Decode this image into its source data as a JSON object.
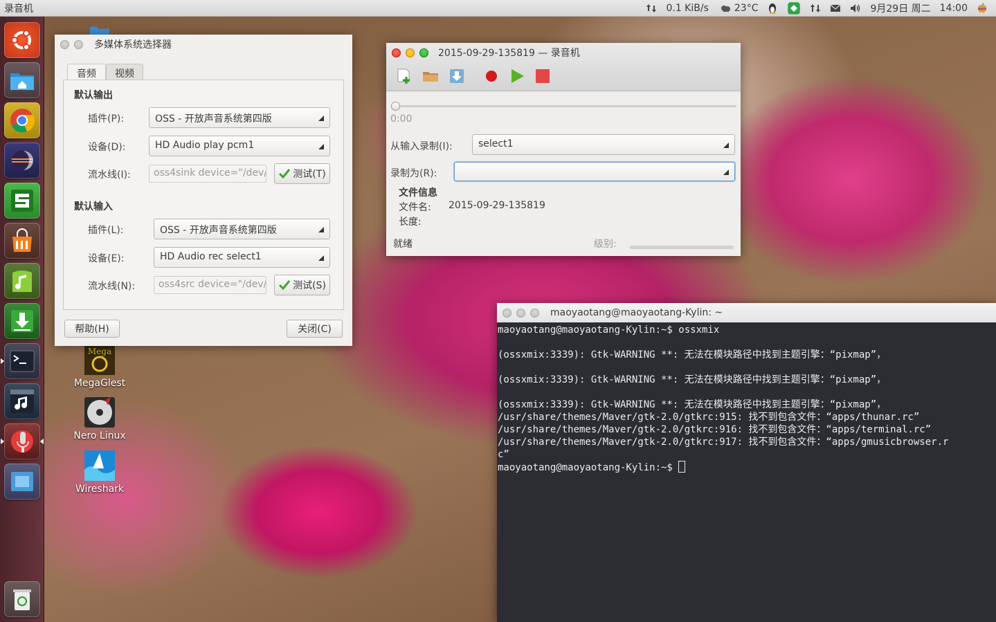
{
  "top_panel": {
    "app_title": "录音机",
    "network_speed": "0.1 KiB/s",
    "weather": "23°C",
    "date": "9月29日 周二",
    "time": "14:00"
  },
  "launcher": {
    "items": [
      "ubuntu-logo-icon",
      "home-folder-icon",
      "chrome-icon",
      "eclipse-icon",
      "sublime-text-icon",
      "software-center-icon",
      "music-player-icon",
      "download-icon",
      "terminal-icon",
      "audio-player-icon",
      "microphone-icon",
      "workspace-switcher-icon",
      "trash-icon"
    ]
  },
  "desktop": {
    "icons": [
      {
        "label": "MegaGlest"
      },
      {
        "label": "Nero Linux"
      },
      {
        "label": "Wireshark"
      }
    ]
  },
  "multimedia_selector": {
    "title": "多媒体系统选择器",
    "tabs": [
      "音频",
      "视频"
    ],
    "output": {
      "heading": "默认输出",
      "plugin_label": "插件(P):",
      "plugin_value": "OSS - 开放声音系统第四版",
      "device_label": "设备(D):",
      "device_value": "HD Audio play pcm1",
      "pipeline_label": "流水线(I):",
      "pipeline_value": "oss4sink device=\"/dev/",
      "test_label": "测试(T)"
    },
    "input": {
      "heading": "默认输入",
      "plugin_label": "插件(L):",
      "plugin_value": "OSS - 开放声音系统第四版",
      "device_label": "设备(E):",
      "device_value": "HD Audio rec select1",
      "pipeline_label": "流水线(N):",
      "pipeline_value": "oss4src device=\"/dev/",
      "test_label": "测试(S)"
    },
    "help_label": "帮助(H)",
    "close_label": "关闭(C)"
  },
  "recorder": {
    "title": "2015-09-29-135819 — 录音机",
    "position_time": "0:00",
    "position_fraction": 0,
    "input_label": "从输入录制(I):",
    "input_value": "select1",
    "record_as_label": "录制为(R):",
    "record_as_value": "",
    "file_info_heading": "文件信息",
    "filename_label": "文件名:",
    "filename_value": "2015-09-29-135819",
    "length_label": "长度:",
    "length_value": "",
    "status": "就绪",
    "level_label": "级别:",
    "level_fraction": 0
  },
  "terminal": {
    "title": "maoyaotang@maoyaotang-Kylin: ~",
    "lines": [
      "maoyaotang@maoyaotang-Kylin:~$ ossxmix",
      "",
      "(ossxmix:3339): Gtk-WARNING **: 无法在模块路径中找到主题引擎：“pixmap”，",
      "",
      "(ossxmix:3339): Gtk-WARNING **: 无法在模块路径中找到主题引擎：“pixmap”，",
      "",
      "(ossxmix:3339): Gtk-WARNING **: 无法在模块路径中找到主题引擎：“pixmap”，",
      "/usr/share/themes/Maver/gtk-2.0/gtkrc:915: 找不到包含文件：“apps/thunar.rc”",
      "/usr/share/themes/Maver/gtk-2.0/gtkrc:916: 找不到包含文件：“apps/terminal.rc”",
      "/usr/share/themes/Maver/gtk-2.0/gtkrc:917: 找不到包含文件：“apps/gmusicbrowser.r",
      "c”"
    ],
    "prompt": "maoyaotang@maoyaotang-Kylin:~$ "
  }
}
